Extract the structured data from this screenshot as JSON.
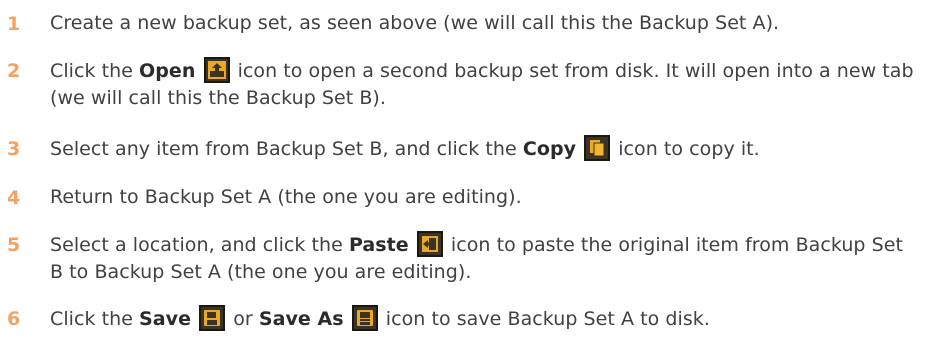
{
  "steps": [
    {
      "number": "1",
      "text": "Create a new backup set, as seen above (we will call this the Backup Set A)."
    },
    {
      "number": "2",
      "pre": "Click the ",
      "bold": "Open",
      "post": " icon to open a second backup set from disk. It will open into a new tab (we will call this the Backup Set B).",
      "icon": "open-icon"
    },
    {
      "number": "3",
      "pre": "Select any item from Backup Set B, and click the ",
      "bold": "Copy",
      "post": " icon to copy it.",
      "icon": "copy-icon"
    },
    {
      "number": "4",
      "text": "Return to Backup Set A (the one you are editing)."
    },
    {
      "number": "5",
      "pre": "Select a location, and click the ",
      "bold": "Paste",
      "post": " icon to paste the original item from Backup Set B to Backup Set A (the one you are editing).",
      "icon": "paste-icon"
    },
    {
      "number": "6",
      "pre": "Click the ",
      "bold": "Save",
      "mid": " or ",
      "bold2": "Save As",
      "post": " icon to save Backup Set A to disk.",
      "icon": "save-icon",
      "icon2": "save-as-icon"
    }
  ],
  "colors": {
    "number": "#f4a261",
    "text": "#414042",
    "icon_bg": "#3b3323",
    "icon_fg": "#f2b632"
  }
}
